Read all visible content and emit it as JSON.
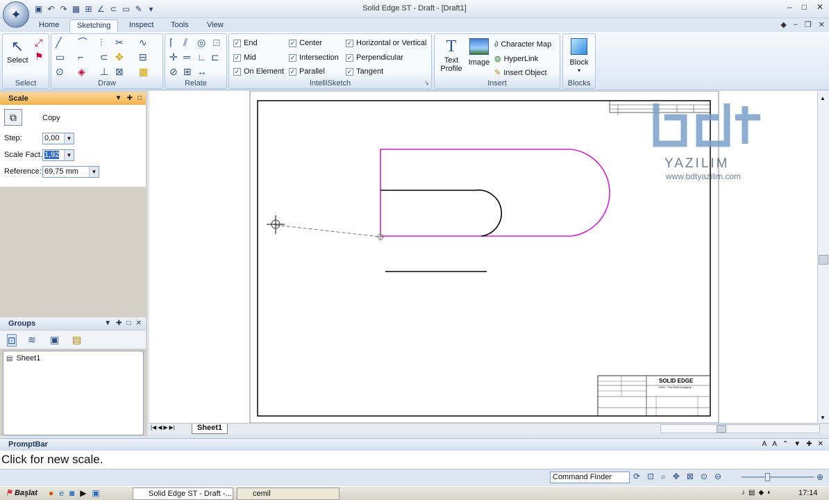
{
  "window": {
    "title": "Solid Edge ST - Draft - [Draft1]"
  },
  "ribbon": {
    "tabs": [
      "Home",
      "Sketching",
      "Inspect",
      "Tools",
      "View"
    ],
    "active_tab": "Sketching",
    "groups": {
      "select": {
        "label": "Select",
        "select_btn": "Select"
      },
      "draw": {
        "label": "Draw"
      },
      "relate": {
        "label": "Relate"
      },
      "intellisketch": {
        "label": "IntelliSketch",
        "end": "End",
        "mid": "Mid",
        "on_element": "On Element",
        "center": "Center",
        "intersection": "Intersection",
        "parallel": "Parallel",
        "horizontal_vertical": "Horizontal or Vertical",
        "perpendicular": "Perpendicular",
        "tangent": "Tangent"
      },
      "insert": {
        "label": "Insert",
        "text_profile_1": "Text",
        "text_profile_2": "Profile",
        "image": "Image",
        "character_map": "Character Map",
        "hyperlink": "HyperLink",
        "insert_object": "Insert Object"
      },
      "blocks": {
        "label": "Blocks",
        "block": "Block"
      }
    }
  },
  "scale_panel": {
    "title": "Scale",
    "copy_label": "Copy",
    "step_label": "Step:",
    "step_value": "0,00",
    "factor_label": "Scale Fact...",
    "factor_value": "1,92",
    "reference_label": "Reference:",
    "reference_value": "69,75 mm"
  },
  "groups_panel": {
    "title": "Groups",
    "items": [
      "Sheet1"
    ]
  },
  "sheet_tab": "Sheet1",
  "title_block": {
    "brand": "SOLID EDGE",
    "sub": "UGS - The PLM Company"
  },
  "watermark": {
    "logo": "bdt",
    "company": "YAZILIM",
    "url": "www.bdtyazilim.com"
  },
  "prompt": {
    "title": "PromptBar",
    "message": "Click for new scale."
  },
  "status": {
    "command_finder": "Command Finder"
  },
  "taskbar": {
    "start": "Başlat",
    "task1": "Solid Edge ST - Draft -...",
    "task2": "cemil",
    "clock": "17:14"
  },
  "colors": {
    "profile": "#cc22cc",
    "accent": "#f3b44c"
  }
}
